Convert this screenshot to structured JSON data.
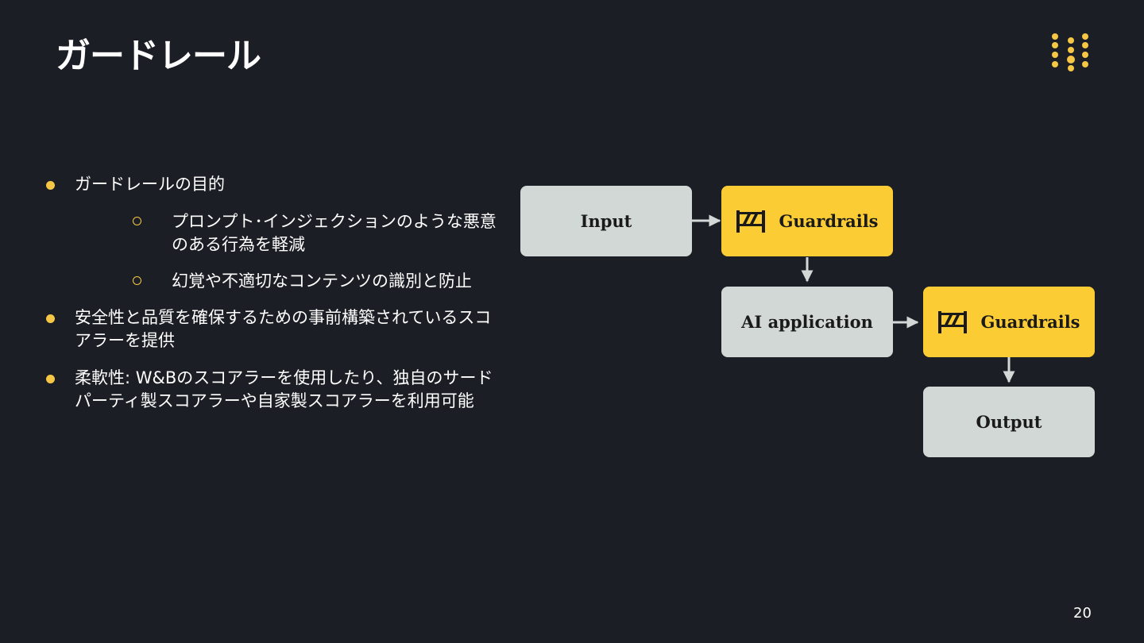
{
  "slide": {
    "title": "ガードレール",
    "page_number": "20"
  },
  "bullets": [
    {
      "text": "ガードレールの目的",
      "children": [
        "プロンプト･インジェクションのような悪意のある行為を軽減",
        "幻覚や不適切なコンテンツの識別と防止"
      ]
    },
    {
      "text": "安全性と品質を確保するための事前構築されているスコアラーを提供"
    },
    {
      "text": "柔軟性: W&Bのスコアラーを使用したり、独自のサードパーティ製スコアラーや自家製スコアラーを利用可能"
    }
  ],
  "diagram": {
    "nodes": {
      "input": "Input",
      "guardrails_1": "Guardrails",
      "ai_application": "AI application",
      "guardrails_2": "Guardrails",
      "output": "Output"
    },
    "colors": {
      "gray_box": "#d2d8d5",
      "yellow_box": "#fccc35",
      "arrow": "#d2d8d5",
      "accent": "#f5c744"
    }
  }
}
